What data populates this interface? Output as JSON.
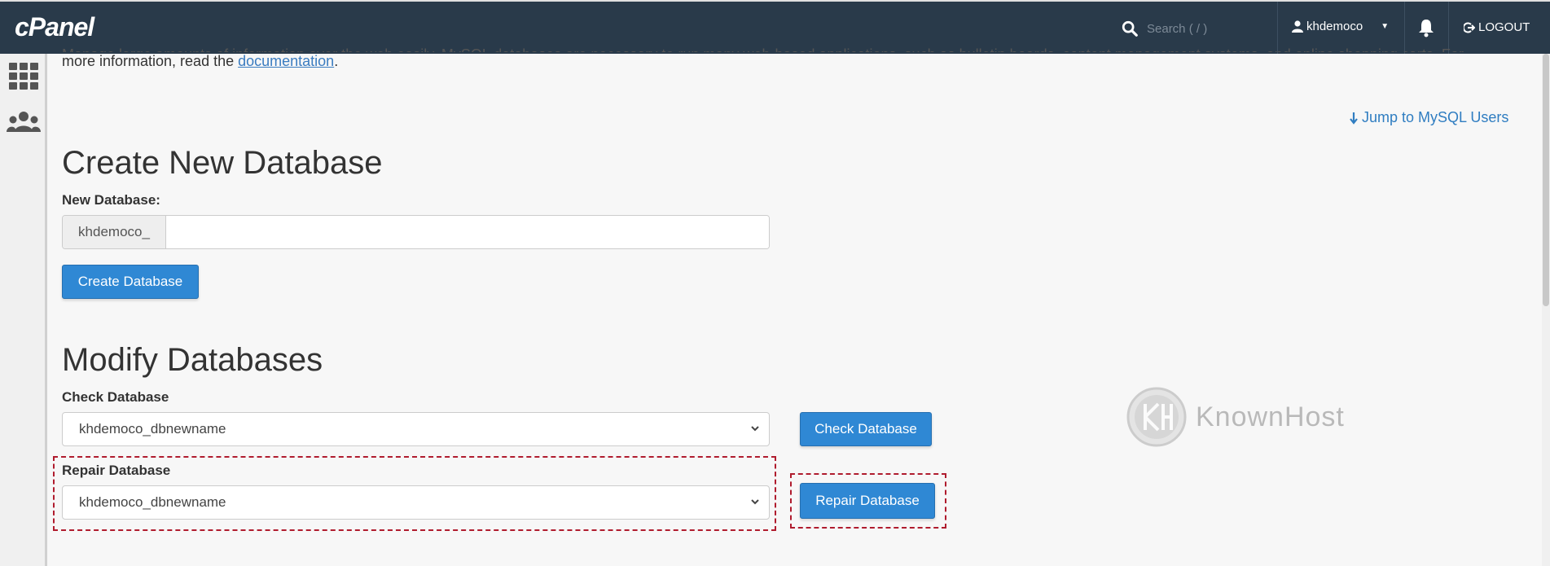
{
  "topbar": {
    "logo": "cPanel",
    "search_placeholder": "Search ( / )",
    "username": "khdemoco",
    "logout_label": "LOGOUT"
  },
  "intro": {
    "cut_line": "Manage large amounts of information over the web easily. MySQL databases are necessary to run many web-based applications, such as bulletin boards, content management systems, and online shopping carts. For",
    "text": "more information, read the ",
    "link": "documentation",
    "suffix": "."
  },
  "jump_link": "Jump to MySQL Users",
  "create": {
    "heading": "Create New Database",
    "label": "New Database:",
    "prefix": "khdemoco_",
    "value": "",
    "button": "Create Database"
  },
  "modify": {
    "heading": "Modify Databases",
    "check_label": "Check Database",
    "check_selected": "khdemoco_dbnewname",
    "check_button": "Check Database",
    "repair_label": "Repair Database",
    "repair_selected": "khdemoco_dbnewname",
    "repair_button": "Repair Database"
  },
  "watermark": {
    "brand": "KnownHost"
  },
  "colors": {
    "topbar": "#293a4a",
    "primary_button": "#2f88d4",
    "highlight": "#b01c2e",
    "link": "#2f7dc1"
  }
}
